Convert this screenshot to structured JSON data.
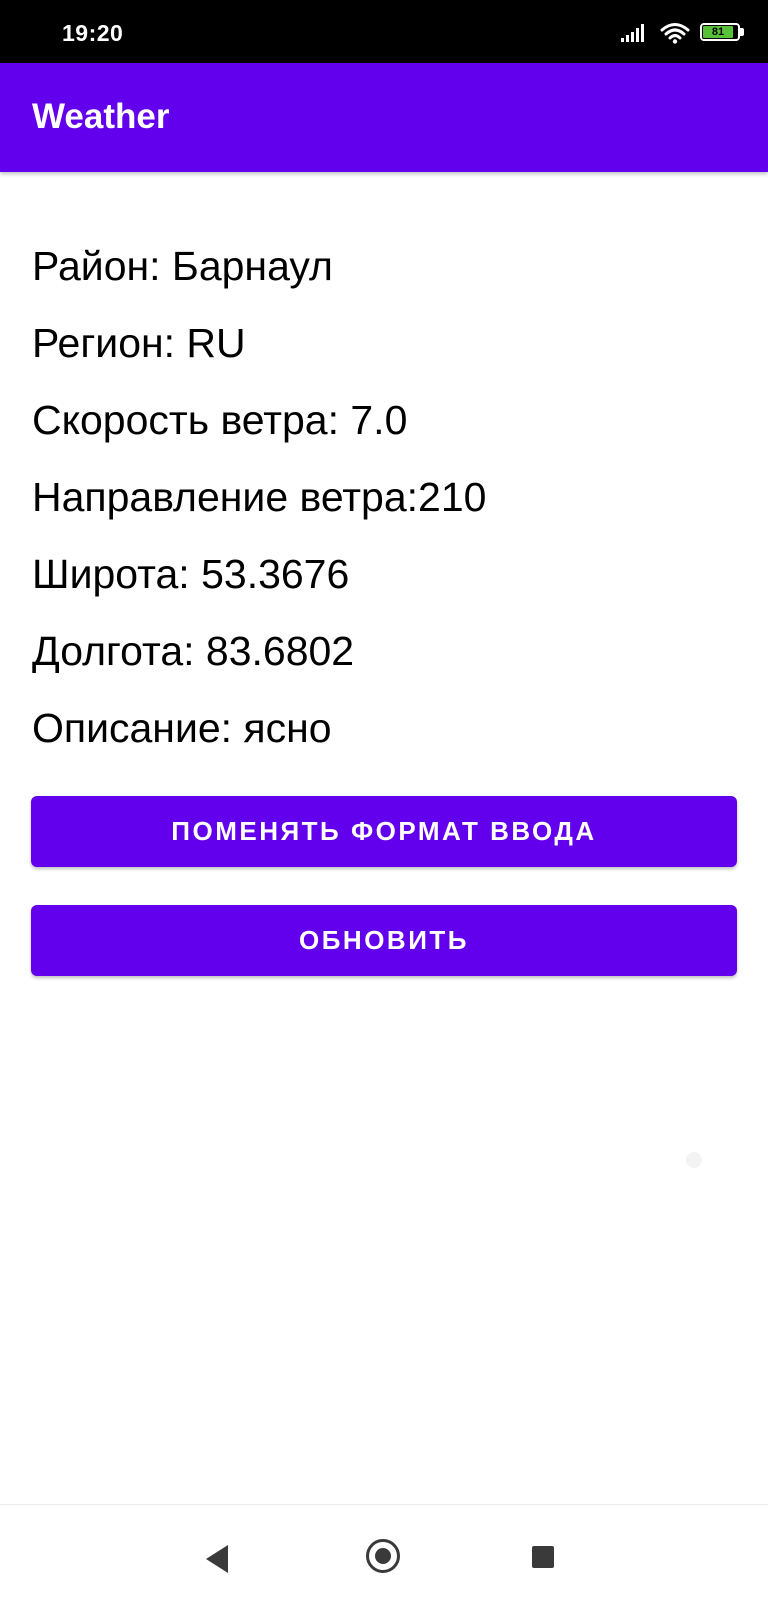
{
  "status_bar": {
    "time": "19:20",
    "battery_level": "81",
    "icons": [
      "signal-icon",
      "wifi-icon",
      "battery-icon"
    ]
  },
  "app_bar": {
    "title": "Weather",
    "color": "#6200ee"
  },
  "weather": {
    "district": "Район: Барнаул",
    "region": "Регион: RU",
    "wind_speed": "Скорость ветра: 7.0",
    "wind_direction": "Направление ветра:210",
    "latitude": "Широта: 53.3676",
    "longitude": "Долгота: 83.6802",
    "description": "Описание: ясно"
  },
  "buttons": {
    "change_format_label": "ПОМЕНЯТЬ ФОРМАТ ВВОДА",
    "refresh_label": "ОБНОВИТЬ"
  },
  "nav_bar": {
    "icons": [
      "back-icon",
      "home-icon",
      "recents-icon"
    ]
  }
}
